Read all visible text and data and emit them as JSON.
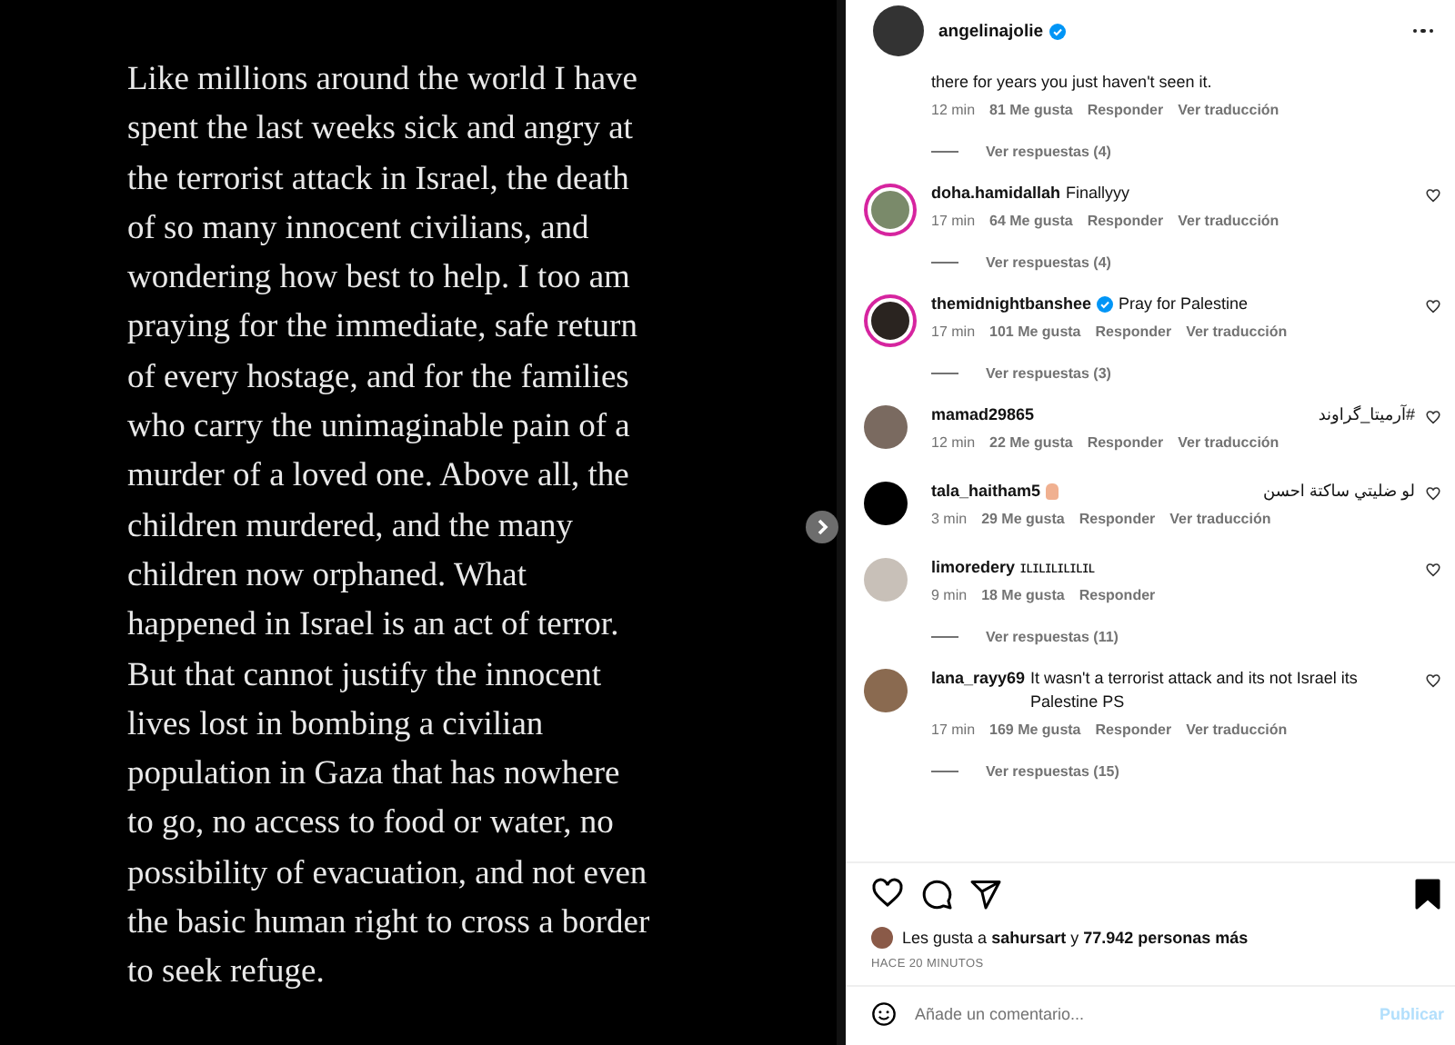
{
  "post_text_lines": [
    "Like millions around the world I have",
    "spent the last weeks sick and angry at",
    "the terrorist attack in Israel, the death",
    "of so many innocent civilians, and",
    "wondering how best to help. I too am",
    "praying for the immediate, safe return",
    "of every hostage, and for the families",
    "who carry the unimaginable pain of a",
    "murder of a loved one. Above all, the",
    "children murdered, and the many",
    "children now orphaned. What",
    "happened in Israel is an act of terror.",
    "But that cannot justify the innocent",
    "lives lost in bombing a civilian",
    "population in Gaza that has nowhere",
    "to go, no access to food or water, no",
    "possibility of evacuation, and not even",
    "the basic human right to cross a border",
    "to seek refuge."
  ],
  "header": {
    "username": "angelinajolie",
    "verified": true
  },
  "comments": [
    {
      "kind": "partial",
      "text": "there for years you just haven't seen it.",
      "time": "12 min",
      "likes": "81 Me gusta",
      "reply": "Responder",
      "translate": "Ver traducción",
      "replies": "Ver respuestas (4)"
    },
    {
      "kind": "full",
      "username": "doha.hamidallah",
      "verified": false,
      "story_ring": true,
      "text": "Finallyyy",
      "time": "17 min",
      "likes": "64 Me gusta",
      "reply": "Responder",
      "translate": "Ver traducción",
      "replies": "Ver respuestas (4)"
    },
    {
      "kind": "full",
      "username": "themidnightbanshee",
      "verified": true,
      "story_ring": true,
      "text": "Pray for Palestine",
      "time": "17 min",
      "likes": "101 Me gusta",
      "reply": "Responder",
      "translate": "Ver traducción",
      "replies": "Ver respuestas (3)"
    },
    {
      "kind": "full",
      "username": "mamad29865",
      "verified": false,
      "story_ring": false,
      "text": "#آرمیتا_گراوند",
      "time": "12 min",
      "likes": "22 Me gusta",
      "reply": "Responder",
      "translate": "Ver traducción"
    },
    {
      "kind": "full",
      "username": "tala_haitham5",
      "verified": false,
      "story_ring": false,
      "text": "لو ضليتي ساكتة احسن",
      "emoji": true,
      "time": "3 min",
      "likes": "29 Me gusta",
      "reply": "Responder",
      "translate": "Ver traducción"
    },
    {
      "kind": "full",
      "username": "limoredery",
      "verified": false,
      "story_ring": false,
      "text": "ɪʟɪʟɪʟɪʟɪʟɪʟ",
      "time": "9 min",
      "likes": "18 Me gusta",
      "reply": "Responder",
      "replies": "Ver respuestas (11)"
    },
    {
      "kind": "full",
      "username": "lana_rayy69",
      "verified": false,
      "story_ring": false,
      "text": "It wasn't a terrorist attack and its not Israel its Palestine PS",
      "time": "17 min",
      "likes": "169 Me gusta",
      "reply": "Responder",
      "translate": "Ver traducción",
      "replies": "Ver respuestas (15)"
    }
  ],
  "likes_summary": {
    "prefix": "Les gusta a",
    "user": "sahursart",
    "middle": "y",
    "count": "77.942 personas más"
  },
  "timestamp": "HACE 20 MINUTOS",
  "saved": true,
  "comment_field": {
    "placeholder": "Añade un comentario...",
    "button": "Publicar"
  }
}
